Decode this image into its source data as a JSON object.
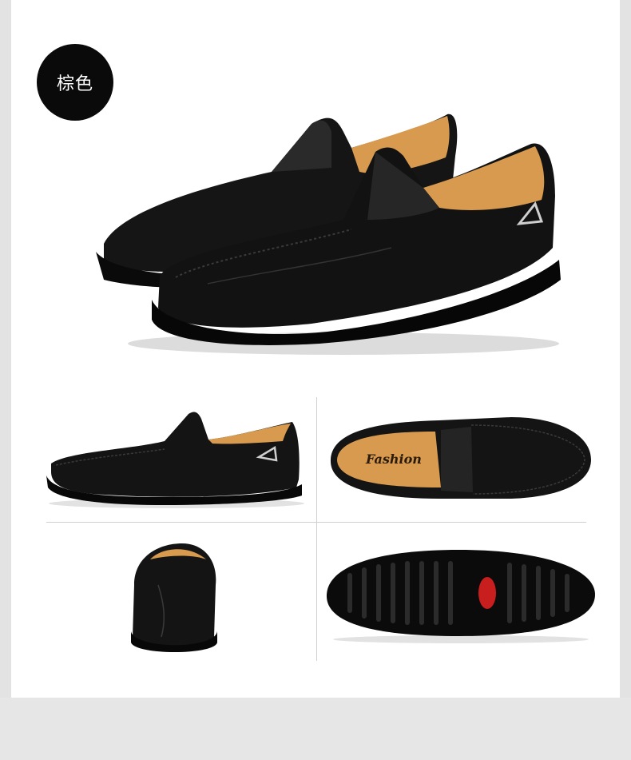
{
  "color_badge": {
    "label": "棕色"
  },
  "insole_brand": {
    "text": "Fashion"
  },
  "palette": {
    "leather": "#141414",
    "leather_highlight": "#3a3a3a",
    "lining": "#d79a4e",
    "sole": "#0b0b0b",
    "sole_mark": "#c81e1e",
    "background": "#ffffff",
    "outer_band": "#e3e3e3"
  },
  "photos": [
    {
      "name": "hero-pair-view"
    },
    {
      "name": "side-view"
    },
    {
      "name": "top-view"
    },
    {
      "name": "back-view"
    },
    {
      "name": "sole-view"
    }
  ]
}
